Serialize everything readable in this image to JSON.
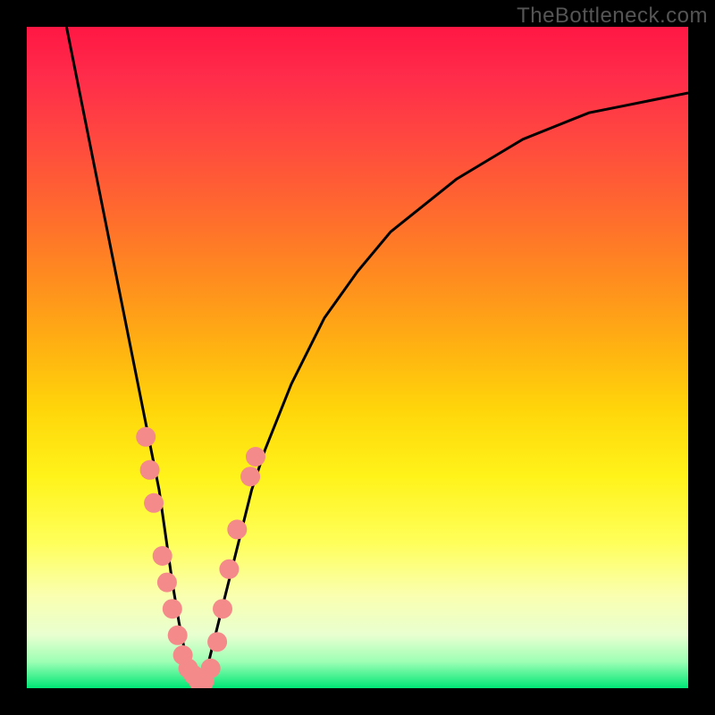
{
  "watermark": "TheBottleneck.com",
  "colors": {
    "frame": "#000000",
    "curve": "#000000",
    "marker_fill": "#f48a8a",
    "marker_stroke": "#f48a8a"
  },
  "chart_data": {
    "type": "line",
    "title": "",
    "xlabel": "",
    "ylabel": "",
    "xlim": [
      0,
      100
    ],
    "ylim": [
      0,
      100
    ],
    "note": "V-shaped bottleneck curve over a red-to-green vertical gradient. y is an implied bottleneck/mismatch percentage (0 at bottom = ideal, 100 at top = severe). x is an unlabeled horizontal scale. Values are estimated from pixel positions.",
    "series": [
      {
        "name": "bottleneck-curve",
        "x": [
          6,
          8,
          10,
          12,
          14,
          16,
          18,
          20,
          21,
          22,
          23,
          24,
          25,
          26,
          27,
          28,
          30,
          32,
          34,
          36,
          40,
          45,
          50,
          55,
          60,
          65,
          70,
          75,
          80,
          85,
          90,
          95,
          100
        ],
        "y": [
          100,
          90,
          80,
          70,
          60,
          50,
          40,
          30,
          23,
          16,
          10,
          5,
          2,
          0,
          2,
          6,
          14,
          22,
          30,
          36,
          46,
          56,
          63,
          69,
          73,
          77,
          80,
          83,
          85,
          87,
          88,
          89,
          90
        ]
      }
    ],
    "markers": {
      "name": "highlighted-points",
      "note": "Pink circular markers clustered near the valley of the curve.",
      "points": [
        {
          "x": 18.0,
          "y": 38
        },
        {
          "x": 18.6,
          "y": 33
        },
        {
          "x": 19.2,
          "y": 28
        },
        {
          "x": 20.5,
          "y": 20
        },
        {
          "x": 21.2,
          "y": 16
        },
        {
          "x": 22.0,
          "y": 12
        },
        {
          "x": 22.8,
          "y": 8
        },
        {
          "x": 23.6,
          "y": 5
        },
        {
          "x": 24.4,
          "y": 3
        },
        {
          "x": 25.2,
          "y": 2
        },
        {
          "x": 26.0,
          "y": 1
        },
        {
          "x": 26.8,
          "y": 1
        },
        {
          "x": 27.8,
          "y": 3
        },
        {
          "x": 28.8,
          "y": 7
        },
        {
          "x": 29.6,
          "y": 12
        },
        {
          "x": 30.6,
          "y": 18
        },
        {
          "x": 31.8,
          "y": 24
        },
        {
          "x": 33.8,
          "y": 32
        },
        {
          "x": 34.6,
          "y": 35
        }
      ]
    }
  }
}
